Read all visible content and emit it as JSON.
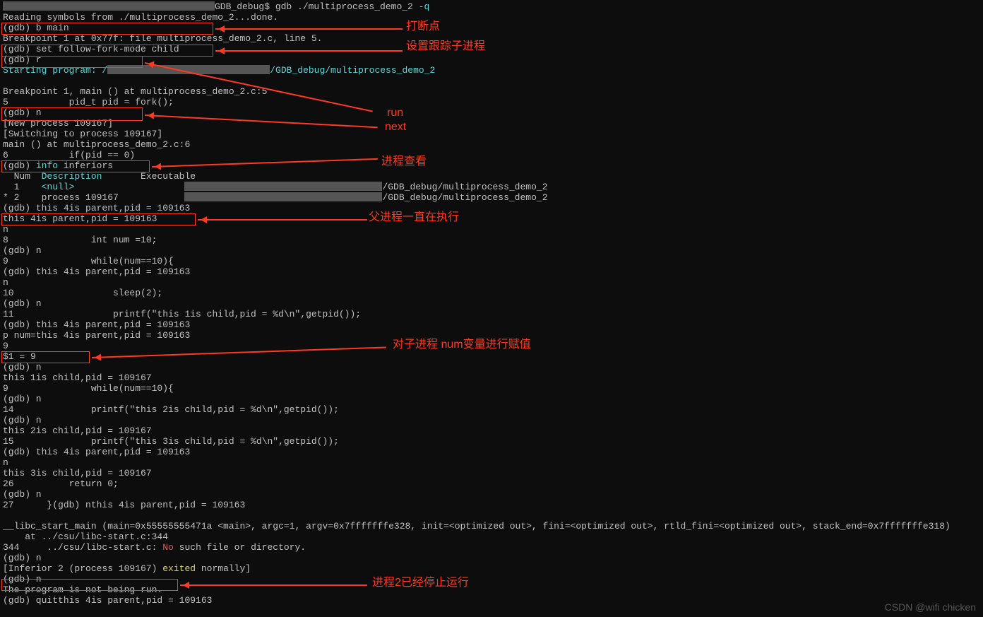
{
  "prompt": "GDB_debug$ gdb ./multiprocess_demo_2",
  "prompt_flag": "-q",
  "read_symbols": "Reading symbols from ./multiprocess_demo_2...done.",
  "b_main": "(gdb) b main",
  "bp_msg": "Breakpoint 1 at 0x77f: file multiprocess_demo_2.c, line 5.",
  "set_follow": "(gdb) set follow-fork-mode child",
  "r": "(gdb) r",
  "start_prog_a": "Starting program: /",
  "start_prog_b": "/GDB_debug/multiprocess_demo_2",
  "bp_hit1": "Breakpoint 1, main () at multiprocess_demo_2.c:5",
  "line5": "5           pid_t pid = fork();",
  "gdb_n1": "(gdb) n",
  "newproc": "[New process 109167]",
  "switching": "[Switching to process 109167]",
  "main_at": "main () at multiprocess_demo_2.c:6",
  "line6": "6           if(pid == 0)",
  "gdb_info_p": "(gdb) ",
  "info_kw": "info",
  "inferiors_t": " inferiors",
  "inf_hdr1": "  Num  ",
  "inf_hdr2": "Description",
  "inf_hdr3": "       Executable",
  "inf_1a": "  1    ",
  "inf_null": "<null>",
  "inf_path": "/GDB_debug/multiprocess_demo_2",
  "inf_2": "* 2    process 109167",
  "gdb_parent1": "(gdb) this 4is parent,pid = 109163",
  "parent_109163": "this 4is parent,pid = 109163",
  "line_n": "n",
  "line8": "8               int num =10;",
  "gdb_n2": "(gdb) n",
  "line9": "9               while(num==10){",
  "gdb_parent_l": "(gdb) this 4is parent,pid = 109163",
  "line_n2": "n",
  "line10": "10                  sleep(2);",
  "gdb_n3": "(gdb) n",
  "line11": "11                  printf(\"this 1is child,pid = %d\\n\",getpid());",
  "gdb_parent_l2": "(gdb) this 4is parent,pid = 109163",
  "p_num": "p num=this 4is parent,pid = 109163",
  "nine": "9",
  "dollar1": "$1 = 9",
  "gdb_n4": "(gdb) n",
  "this1child": "this 1is child,pid = 109167",
  "line9b": "9               while(num==10){",
  "gdb_n5": "(gdb) n",
  "line14": "14              printf(\"this 2is child,pid = %d\\n\",getpid());",
  "gdb_n6": "(gdb) n",
  "this2child": "this 2is child,pid = 109167",
  "line15": "15              printf(\"this 3is child,pid = %d\\n\",getpid());",
  "gdb_parent_l3": "(gdb) this 4is parent,pid = 109163",
  "line_n3": "n",
  "this3child": "this 3is child,pid = 109167",
  "line26": "26          return 0;",
  "gdb_n7": "(gdb) n",
  "line27": "27      }(gdb) nthis 4is parent,pid = 109163",
  "libc": "__libc_start_main (main=0x55555555471a <main>, argc=1, argv=0x7fffffffe328, init=<optimized out>, fini=<optimized out>, rtld_fini=<optimized out>, stack_end=0x7fffffffe318)",
  "libc_at": "    at ../csu/libc-start.c:344",
  "line344a": "344     ../csu/libc-start.c: ",
  "line344_no": "No",
  "line344b": " such file or directory.",
  "gdb_n8": "(gdb) n",
  "inferior2a": "[Inferior 2 (process 109167) ",
  "inferior2_exited": "exited",
  "inferior2b": " normally]",
  "gdb_n9": "(gdb) n",
  "not_running": "The program is not being run.",
  "gdb_quit": "(gdb) quitthis 4is parent,pid = 109163",
  "annot": {
    "a1": "打断点",
    "a2": "设置跟踪子进程",
    "a3": "run",
    "a4": "next",
    "a5": "进程查看",
    "a6": "父进程一直在执行",
    "a7": "对子进程 num变量进行赋值",
    "a8": "进程2已经停止运行"
  },
  "watermark": "CSDN @wifi chicken"
}
